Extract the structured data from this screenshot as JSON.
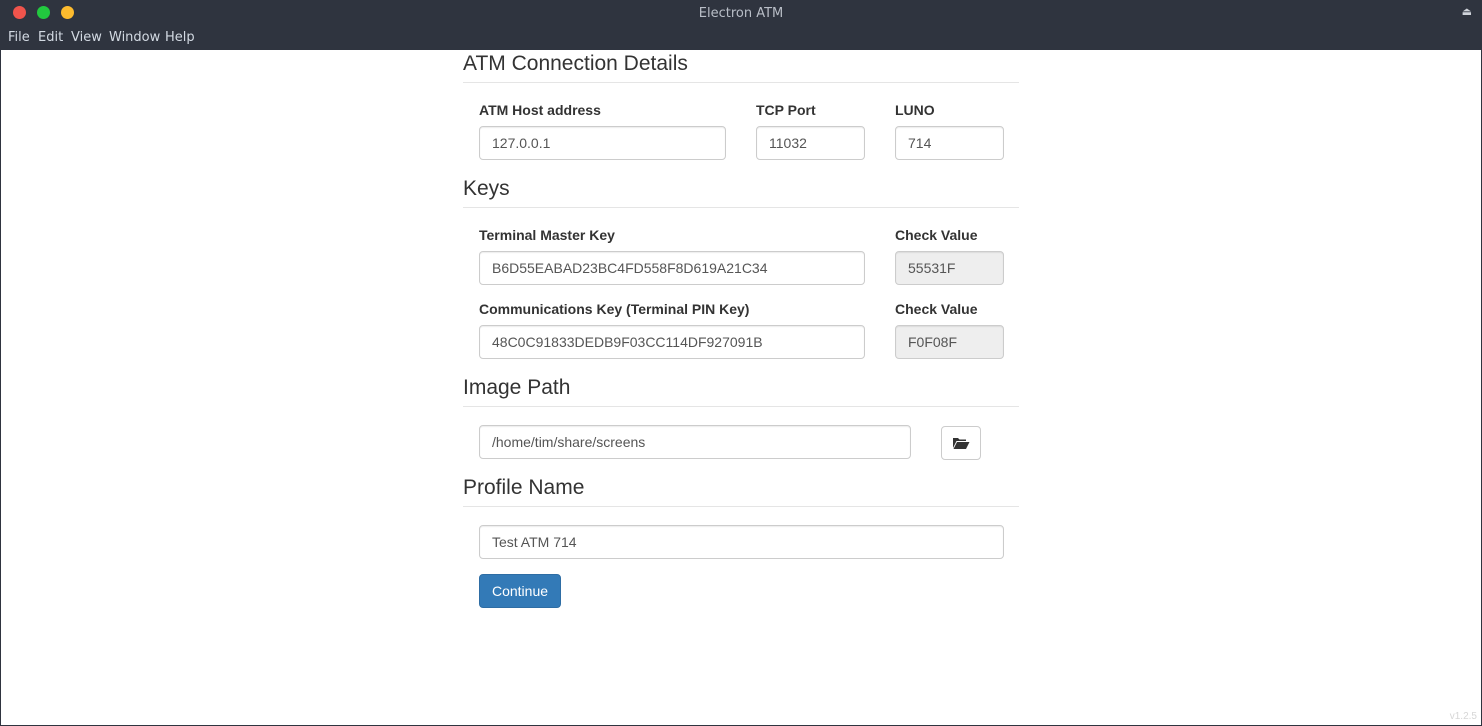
{
  "window": {
    "title": "Electron ATM",
    "control_glyph": "⏏",
    "menu": [
      "File",
      "Edit",
      "View",
      "Window",
      "Help"
    ]
  },
  "connection": {
    "heading": "ATM Connection Details",
    "host_label": "ATM Host address",
    "host_value": "127.0.0.1",
    "port_label": "TCP Port",
    "port_value": "11032",
    "luno_label": "LUNO",
    "luno_value": "714"
  },
  "keys": {
    "heading": "Keys",
    "master_label": "Terminal Master Key",
    "master_value": "B6D55EABAD23BC4FD558F8D619A21C34",
    "master_check_label": "Check Value",
    "master_check_value": "55531F",
    "comms_label": "Communications Key (Terminal PIN Key)",
    "comms_value": "48C0C91833DEDB9F03CC114DF927091B",
    "comms_check_label": "Check Value",
    "comms_check_value": "F0F08F"
  },
  "image_path": {
    "heading": "Image Path",
    "value": "/home/tim/share/screens",
    "browse_icon": "folder-open-icon"
  },
  "profile": {
    "heading": "Profile Name",
    "value": "Test ATM 714"
  },
  "continue_label": "Continue",
  "version": "v1.2.5",
  "colors": {
    "titlebar": "#2f343f",
    "primary_button": "#337ab7",
    "close": "#f0544c",
    "maximize": "#22c93f",
    "minimize": "#fdbb2e"
  }
}
